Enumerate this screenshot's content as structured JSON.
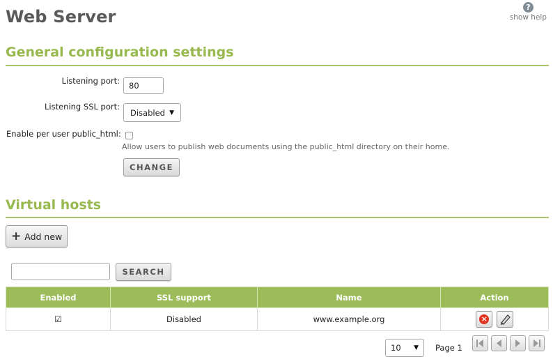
{
  "header": {
    "title": "Web Server",
    "help_label": "show help",
    "help_glyph": "?"
  },
  "general": {
    "title": "General configuration settings",
    "listening_port_label": "Listening port:",
    "listening_port_value": "80",
    "ssl_port_label": "Listening SSL port:",
    "ssl_port_selected": "Disabled",
    "public_html_label": "Enable per user public_html:",
    "public_html_checked": false,
    "public_html_hint": "Allow users to publish web documents using the public_html directory on their home.",
    "change_button": "CHANGE"
  },
  "vhosts": {
    "title": "Virtual hosts",
    "add_button": "Add new",
    "search_value": "",
    "search_button": "SEARCH",
    "columns": [
      "Enabled",
      "SSL support",
      "Name",
      "Action"
    ],
    "rows": [
      {
        "enabled": true,
        "ssl": "Disabled",
        "name": "www.example.org"
      }
    ],
    "page_size": "10",
    "page_label": "Page 1"
  },
  "colors": {
    "accent": "#97b94f",
    "table_header": "#9bbc59",
    "delete": "#e2331f"
  },
  "icons": {
    "help": "help-circle-icon",
    "add": "plus-icon",
    "delete": "delete-circle-icon",
    "edit": "pencil-icon",
    "first": "first-page-icon",
    "prev": "previous-page-icon",
    "next": "next-page-icon",
    "last": "last-page-icon"
  }
}
